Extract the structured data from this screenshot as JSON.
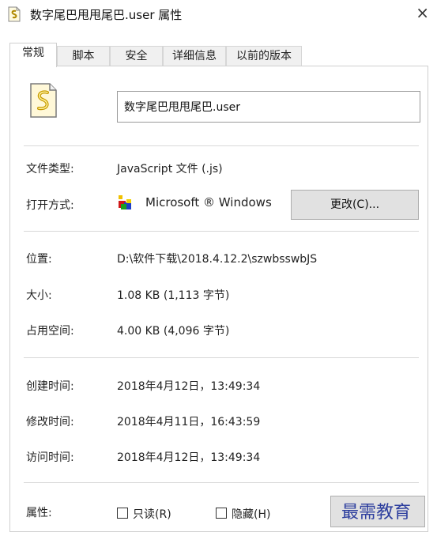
{
  "window": {
    "title": "数字尾巴甩甩尾巴.user 属性",
    "close_glyph": "×"
  },
  "tabs": [
    {
      "label": "常规",
      "active": true
    },
    {
      "label": "脚本",
      "active": false
    },
    {
      "label": "安全",
      "active": false
    },
    {
      "label": "详细信息",
      "active": false
    },
    {
      "label": "以前的版本",
      "active": false
    }
  ],
  "general": {
    "file_name": "数字尾巴甩甩尾巴.user",
    "file_type_label": "文件类型:",
    "file_type_value": "JavaScript 文件 (.js)",
    "opens_with_label": "打开方式:",
    "opens_with_value": "Microsoft ® Windows",
    "change_button": "更改(C)...",
    "location_label": "位置:",
    "location_value": "D:\\软件下载\\2018.4.12.2\\szwbsswbJS",
    "size_label": "大小:",
    "size_value": "1.08 KB (1,113 字节)",
    "size_on_disk_label": "占用空间:",
    "size_on_disk_value": "4.00 KB (4,096 字节)",
    "created_label": "创建时间:",
    "created_value": "2018年4月12日，13:49:34",
    "modified_label": "修改时间:",
    "modified_value": "2018年4月11日，16:43:59",
    "accessed_label": "访问时间:",
    "accessed_value": "2018年4月12日，13:49:34",
    "attributes_label": "属性:",
    "readonly_label": "只读(R)",
    "readonly_checked": false,
    "hidden_label": "隐藏(H)",
    "hidden_checked": false,
    "advanced_button": ""
  },
  "watermark": "最需教育",
  "icons": {
    "title": "script-file-icon",
    "file": "script-file-icon",
    "app": "windows-script-host-icon"
  }
}
